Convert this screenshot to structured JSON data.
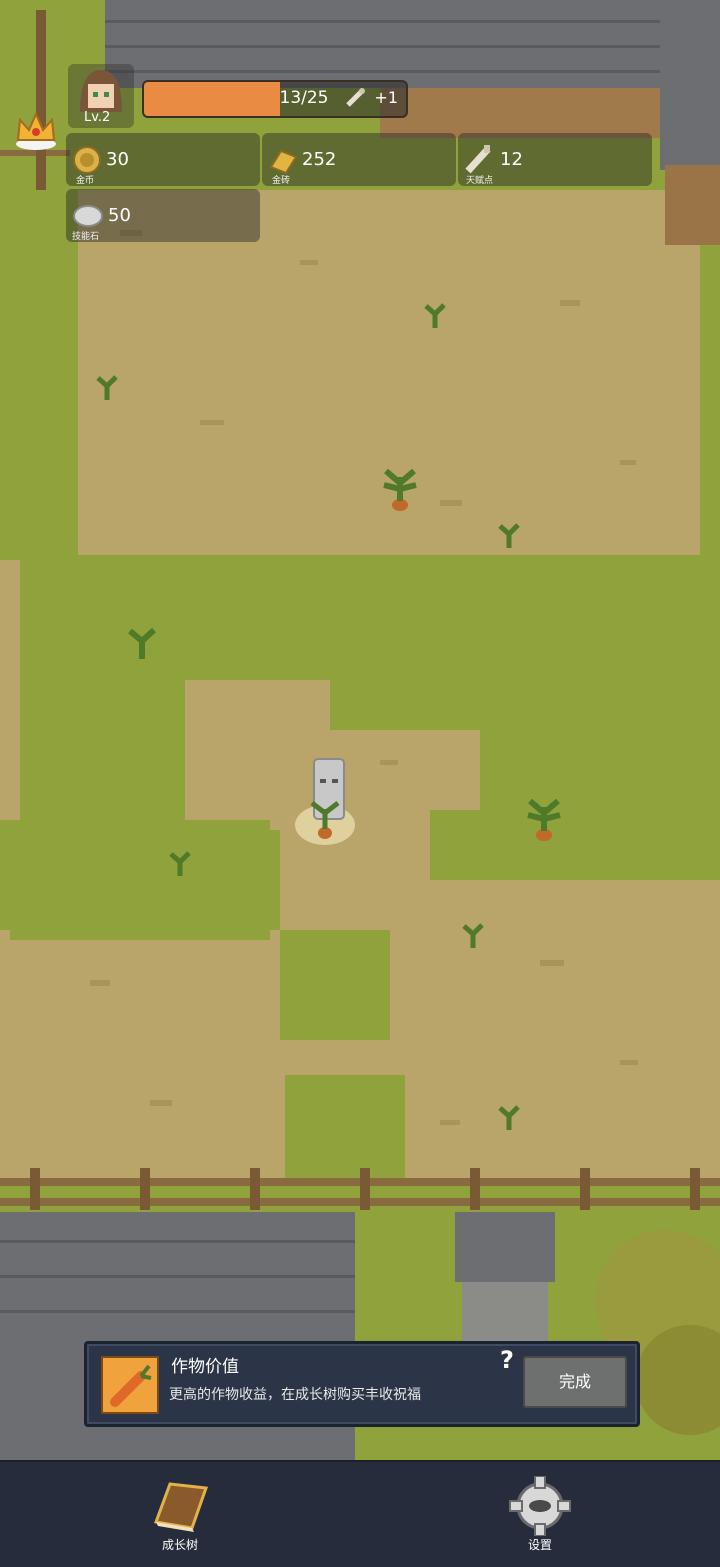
{
  "player": {
    "level": "Lv.2",
    "xp_text": "13/25",
    "xp_fraction": 0.52,
    "xp_bonus": "+1"
  },
  "resources": {
    "coins": {
      "value": "30",
      "label": "金币"
    },
    "gold_bars": {
      "value": "252",
      "label": "金砖"
    },
    "talent": {
      "value": "12",
      "label": "天赋点"
    },
    "skill_stone": {
      "value": "50",
      "label": "技能石"
    }
  },
  "task_banner": {
    "title": "作物价值",
    "description": "更高的作物收益，在成长树购买丰收祝福",
    "help_glyph": "?",
    "done_label": "完成"
  },
  "bottom_nav": {
    "growth_tree": "成长树",
    "settings": "设置"
  },
  "colors": {
    "grass": "#8fa23b",
    "soil": "#b9a46a",
    "roof": "#6d6e72",
    "xp_fill": "#e98b43",
    "bottom_bar": "#262c3b",
    "banner": "#2b3547"
  }
}
